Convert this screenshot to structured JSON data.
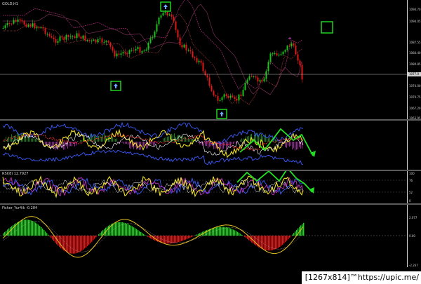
{
  "main_chart": {
    "symbol_label": "GOLD,H1",
    "price_ticks": [
      "1094.70",
      "1094.05",
      "1087.55",
      "1084.40",
      "1080.85",
      "1077.25",
      "1074.00",
      "1070.75",
      "1067.20",
      "1063.95"
    ],
    "current_price": "1077.0",
    "colors": {
      "bull_candle": "#19c319",
      "bear_candle": "#e01818",
      "ma1": "#9a2a6a",
      "ma2": "#6a2a4a",
      "ma3": "#a83a3a"
    }
  },
  "indicator_1": {
    "label": "",
    "colors": {
      "line_blue": "#3b5cff",
      "line_yellow": "#f0e020",
      "line_red": "#ff3030",
      "line_white": "#ffffff",
      "hist_green": "#1faa1f",
      "hist_magenta": "#d030d0"
    }
  },
  "indicator_2": {
    "label": "RSI(8) 12.7927",
    "ticks": [
      "100",
      "76",
      "52",
      "0"
    ]
  },
  "indicator_3": {
    "label": "Fisher_Yur4ik -0.284",
    "ticks": [
      "2.077",
      "0.00",
      "-2.267"
    ],
    "colors": {
      "hist_green": "#22d022",
      "hist_red": "#e01818",
      "signal_line": "#e8c020"
    }
  },
  "annotations": {
    "arrow_boxes": [
      "up-arrow",
      "up-arrow",
      "up-arrow"
    ],
    "empty_box": "green-square",
    "zigzags": [
      "zigzag-1",
      "zigzag-2"
    ]
  },
  "watermark": "[1267x814]™https://upic.me/"
}
